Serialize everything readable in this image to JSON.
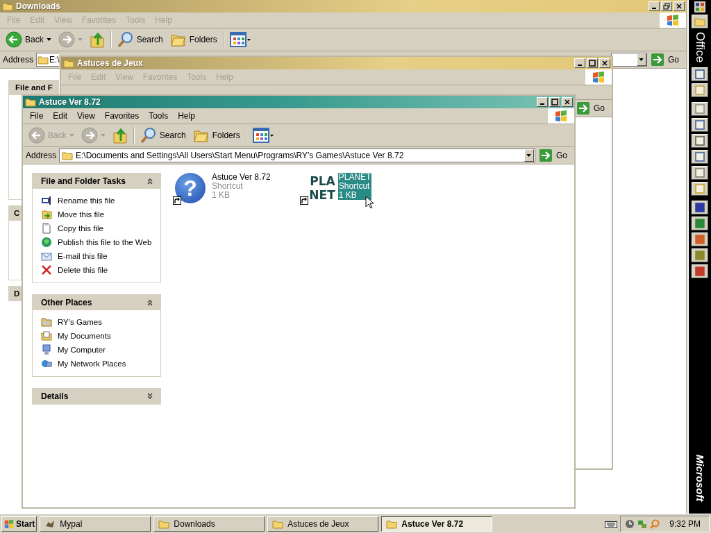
{
  "windows": [
    {
      "title": "Downloads",
      "active": false,
      "menu": [
        "File",
        "Edit",
        "View",
        "Favorites",
        "Tools",
        "Help"
      ],
      "toolbar": [
        {
          "kind": "back",
          "label": "Back",
          "disabled": false
        },
        {
          "kind": "forward",
          "disabled": true
        },
        {
          "kind": "up"
        },
        {
          "kind": "search",
          "label": "Search"
        },
        {
          "kind": "folders",
          "label": "Folders"
        },
        {
          "kind": "views"
        }
      ],
      "address": {
        "label": "Address",
        "value": "E:\\"
      },
      "go": "Go",
      "panes": [
        {
          "title": "File and F"
        },
        {
          "title": "C"
        },
        {
          "title": "D"
        }
      ]
    },
    {
      "title": "Astuces de Jeux",
      "active": false,
      "menu": [
        "File",
        "Edit",
        "View",
        "Favorites",
        "Tools",
        "Help"
      ],
      "go": "Go"
    },
    {
      "title": "Astuce Ver 8.72",
      "active": true,
      "menu": [
        "File",
        "Edit",
        "View",
        "Favorites",
        "Tools",
        "Help"
      ],
      "toolbar": [
        {
          "kind": "back",
          "label": "Back",
          "disabled": true
        },
        {
          "kind": "forward",
          "disabled": true
        },
        {
          "kind": "up"
        },
        {
          "kind": "search",
          "label": "Search"
        },
        {
          "kind": "folders",
          "label": "Folders"
        },
        {
          "kind": "views"
        }
      ],
      "address": {
        "label": "Address",
        "value": "E:\\Documents and Settings\\All Users\\Start Menu\\Programs\\RY's Games\\Astuce Ver 8.72"
      },
      "go": "Go",
      "panes": [
        {
          "title": "File and Folder Tasks",
          "expanded": true,
          "items": [
            "Rename this file",
            "Move this file",
            "Copy this file",
            "Publish this file to the Web",
            "E-mail this file",
            "Delete this file"
          ]
        },
        {
          "title": "Other Places",
          "expanded": true,
          "items": [
            "RY's Games",
            "My Documents",
            "My Computer",
            "My Network Places"
          ]
        },
        {
          "title": "Details",
          "expanded": false
        }
      ],
      "files": [
        {
          "kind": "help",
          "glyph": "?",
          "name": "Astuce Ver 8.72",
          "type": "Shortcut",
          "size": "1 KB",
          "selected": false
        },
        {
          "kind": "logo",
          "logo": [
            "PLA",
            "NET"
          ],
          "name": "PLANET",
          "type": "Shortcut",
          "size": "1 KB",
          "selected": true
        }
      ]
    }
  ],
  "office_bar": {
    "title": "Office",
    "footer": "Microsoft"
  },
  "taskbar": {
    "start": "Start",
    "buttons": [
      {
        "label": "Mypal",
        "kind": "app",
        "selected": false
      },
      {
        "label": "Downloads",
        "kind": "folder",
        "selected": false
      },
      {
        "label": "Astuces de Jeux",
        "kind": "folder",
        "selected": false
      },
      {
        "label": "Astuce Ver 8.72",
        "kind": "folder",
        "selected": true
      }
    ],
    "clock": "9:32 PM"
  }
}
